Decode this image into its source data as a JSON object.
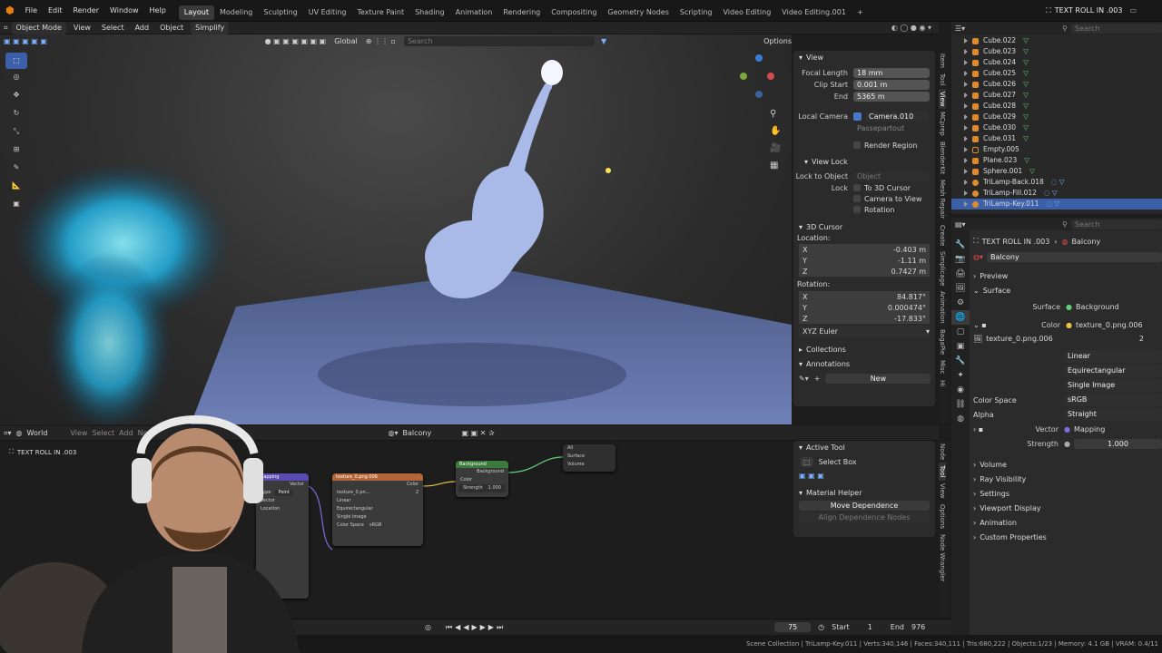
{
  "menu": [
    "File",
    "Edit",
    "Render",
    "Window",
    "Help"
  ],
  "workspaces": [
    "Layout",
    "Modeling",
    "Sculpting",
    "UV Editing",
    "Texture Paint",
    "Shading",
    "Animation",
    "Rendering",
    "Compositing",
    "Geometry Nodes",
    "Scripting",
    "Video Editing",
    "Video Editing.001"
  ],
  "active_workspace": "Layout",
  "scene_name": "TEXT ROLL IN .003",
  "view_layer_placeholder": "Search",
  "viewport_header": {
    "mode": "Object Mode",
    "items": [
      "View",
      "Select",
      "Add",
      "Object"
    ],
    "simplify": "Simplify",
    "orientation": "Global",
    "search_placeholder": "Search",
    "options": "Options"
  },
  "view_panel": {
    "title": "View",
    "focal_length_label": "Focal Length",
    "focal_length": "18 mm",
    "clip_start_label": "Clip Start",
    "clip_start": "0.001 m",
    "end_label": "End",
    "end": "5365 m",
    "local_camera_label": "Local Camera",
    "local_camera": "Camera.010",
    "passepartout": "Passepartout",
    "render_region": "Render Region",
    "view_lock": "View Lock",
    "lock_to_object_label": "Lock to Object",
    "lock_to_object_placeholder": "Object",
    "lock_label": "Lock",
    "lock_3d_cursor": "To 3D Cursor",
    "camera_to_view": "Camera to View",
    "rotation": "Rotation"
  },
  "cursor_panel": {
    "title": "3D Cursor",
    "location_label": "Location:",
    "loc_x": "-0.403 m",
    "loc_y": "-1.11 m",
    "loc_z": "0.7427 m",
    "rotation_label": "Rotation:",
    "rot_x": "84.817°",
    "rot_y": "0.000474°",
    "rot_z": "-17.833°",
    "mode": "XYZ Euler",
    "axes": [
      "X",
      "Y",
      "Z"
    ]
  },
  "collections_label": "Collections",
  "annotations_label": "Annotations",
  "new_label": "New",
  "sidebar_tabs": [
    "Item",
    "Tool",
    "View",
    "MCprep",
    "BlenderKit",
    "Mesh Repair",
    "Create",
    "Simplicage",
    "Animation",
    "BagaPie",
    "Misc",
    "Hi"
  ],
  "outliner": [
    {
      "name": "Cube.022",
      "type": "mesh"
    },
    {
      "name": "Cube.023",
      "type": "mesh"
    },
    {
      "name": "Cube.024",
      "type": "mesh"
    },
    {
      "name": "Cube.025",
      "type": "mesh"
    },
    {
      "name": "Cube.026",
      "type": "mesh"
    },
    {
      "name": "Cube.027",
      "type": "mesh"
    },
    {
      "name": "Cube.028",
      "type": "mesh"
    },
    {
      "name": "Cube.029",
      "type": "mesh"
    },
    {
      "name": "Cube.030",
      "type": "mesh"
    },
    {
      "name": "Cube.031",
      "type": "mesh"
    },
    {
      "name": "Empty.005",
      "type": "empty"
    },
    {
      "name": "Plane.023",
      "type": "mesh"
    },
    {
      "name": "Sphere.001",
      "type": "mesh"
    },
    {
      "name": "TriLamp-Back.018",
      "type": "light"
    },
    {
      "name": "TriLamp-Fill.012",
      "type": "light"
    },
    {
      "name": "TriLamp-Key.011",
      "type": "light",
      "selected": true
    }
  ],
  "properties": {
    "scene": "TEXT ROLL IN .003",
    "world": "Balcony",
    "world_field": "Balcony",
    "preview": "Preview",
    "surface_section": "Surface",
    "surface_label": "Surface",
    "surface_value": "Background",
    "color_label": "Color",
    "color_value": "texture_0.png.006",
    "image_name": "texture_0.png.006",
    "users": "2",
    "interp": "Linear",
    "projection": "Equirectangular",
    "source": "Single Image",
    "color_space_label": "Color Space",
    "color_space": "sRGB",
    "alpha_label": "Alpha",
    "alpha": "Straight",
    "vector_label": "Vector",
    "vector_value": "Mapping",
    "strength_label": "Strength",
    "strength": "1.000",
    "sections": [
      "Volume",
      "Ray Visibility",
      "Settings",
      "Viewport Display",
      "Animation",
      "Custom Properties"
    ]
  },
  "node_editor": {
    "world_label": "World",
    "items": [
      "View",
      "Select",
      "Add",
      "Node"
    ],
    "world_name": "Balcony",
    "breadcrumb": "TEXT ROLL IN .003",
    "nodes": {
      "mapping": {
        "title": "Mapping",
        "type": "Type",
        "type_value": "Point",
        "vector": "Vector",
        "location": "Location"
      },
      "texture": {
        "title": "texture_0.png.006",
        "image": "texture_0.pn...",
        "users": "2",
        "interp": "Linear",
        "projection": "Equirectangular",
        "source": "Single Image",
        "color_space_label": "Color Space",
        "color_space": "sRGB",
        "alpha_label": "Alpha",
        "alpha": "Straight",
        "vector": "Vector",
        "color_out": "Color"
      },
      "background": {
        "title": "Background",
        "out": "Background",
        "color": "Color",
        "strength": "Strength",
        "strength_val": "1.000"
      },
      "output": {
        "title": "All",
        "surface": "Surface",
        "volume": "Volume"
      }
    }
  },
  "tool_panel": {
    "active_tool": "Active Tool",
    "select_box": "Select Box",
    "material_helper": "Material Helper",
    "move_dependence": "Move Dependence",
    "align_dependence": "Align Dependence Nodes"
  },
  "node_tabs": [
    "Node",
    "Tool",
    "View",
    "Options",
    "Node Wrangler"
  ],
  "timeline": {
    "frame": "75",
    "start_label": "Start",
    "start": "1",
    "end_label": "End",
    "end": "976"
  },
  "status": "Scene Collection | TriLamp-Key.011 | Verts:340,146 | Faces:340,111 | Tris:680,222 | Objects:1/23 | Memory: 4.1 GB | VRAM: 0.4/11"
}
